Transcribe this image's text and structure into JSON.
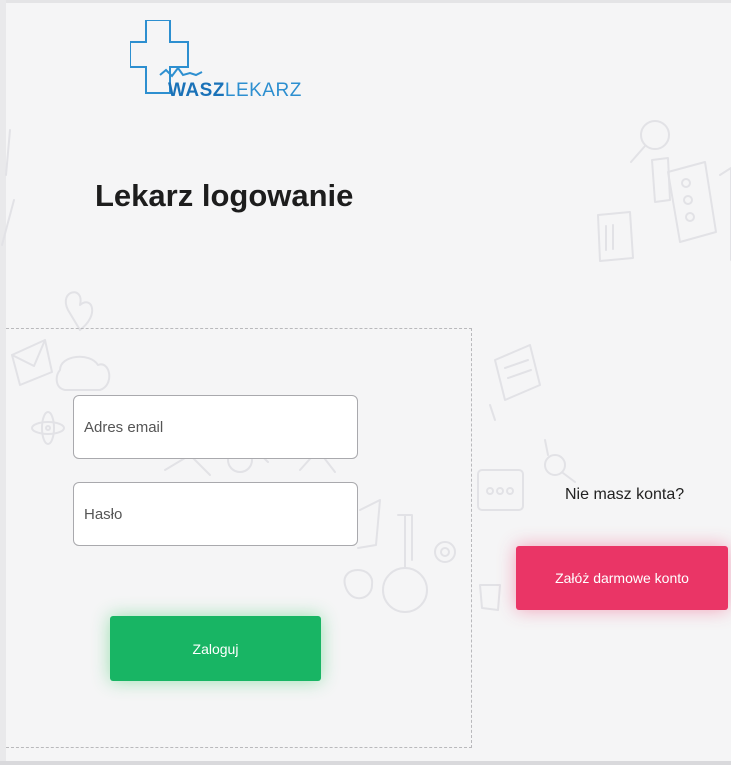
{
  "logo": {
    "text_bold": "WASZ",
    "text_light": "LEKARZ"
  },
  "title": {
    "bold": "Lekarz",
    "regular": " logowanie"
  },
  "login_form": {
    "email_placeholder": "Adres email",
    "password_placeholder": "Hasło",
    "login_button": "Zaloguj"
  },
  "register": {
    "prompt": "Nie masz konta?",
    "button": "Załóż darmowe konto"
  },
  "colors": {
    "background": "#f5f5f6",
    "brand_blue": "#1a72b8",
    "login_green": "#18b564",
    "register_pink": "#ea3566"
  }
}
